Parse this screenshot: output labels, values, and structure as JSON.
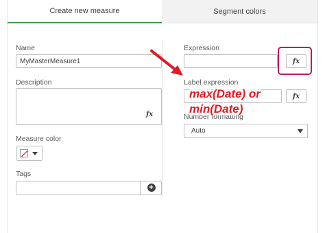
{
  "tabs": [
    {
      "label": "Create new measure",
      "active": true
    },
    {
      "label": "Segment colors",
      "active": false
    }
  ],
  "left": {
    "name_label": "Name",
    "name_value": "MyMasterMeasure1",
    "description_label": "Description",
    "measure_color_label": "Measure color",
    "tags_label": "Tags",
    "fx_icon": "fx"
  },
  "right": {
    "expression_label": "Expression",
    "label_expression_label": "Label expression",
    "number_formatting_label": "Number formatting",
    "number_formatting_value": "Auto",
    "fx_icon": "fx"
  },
  "annotation": {
    "line1": "max(Date) or",
    "line2": "min(Date)"
  },
  "colors": {
    "accent": "#3d9f4f",
    "annotation": "#e01b24",
    "highlight": "#c2185b"
  }
}
